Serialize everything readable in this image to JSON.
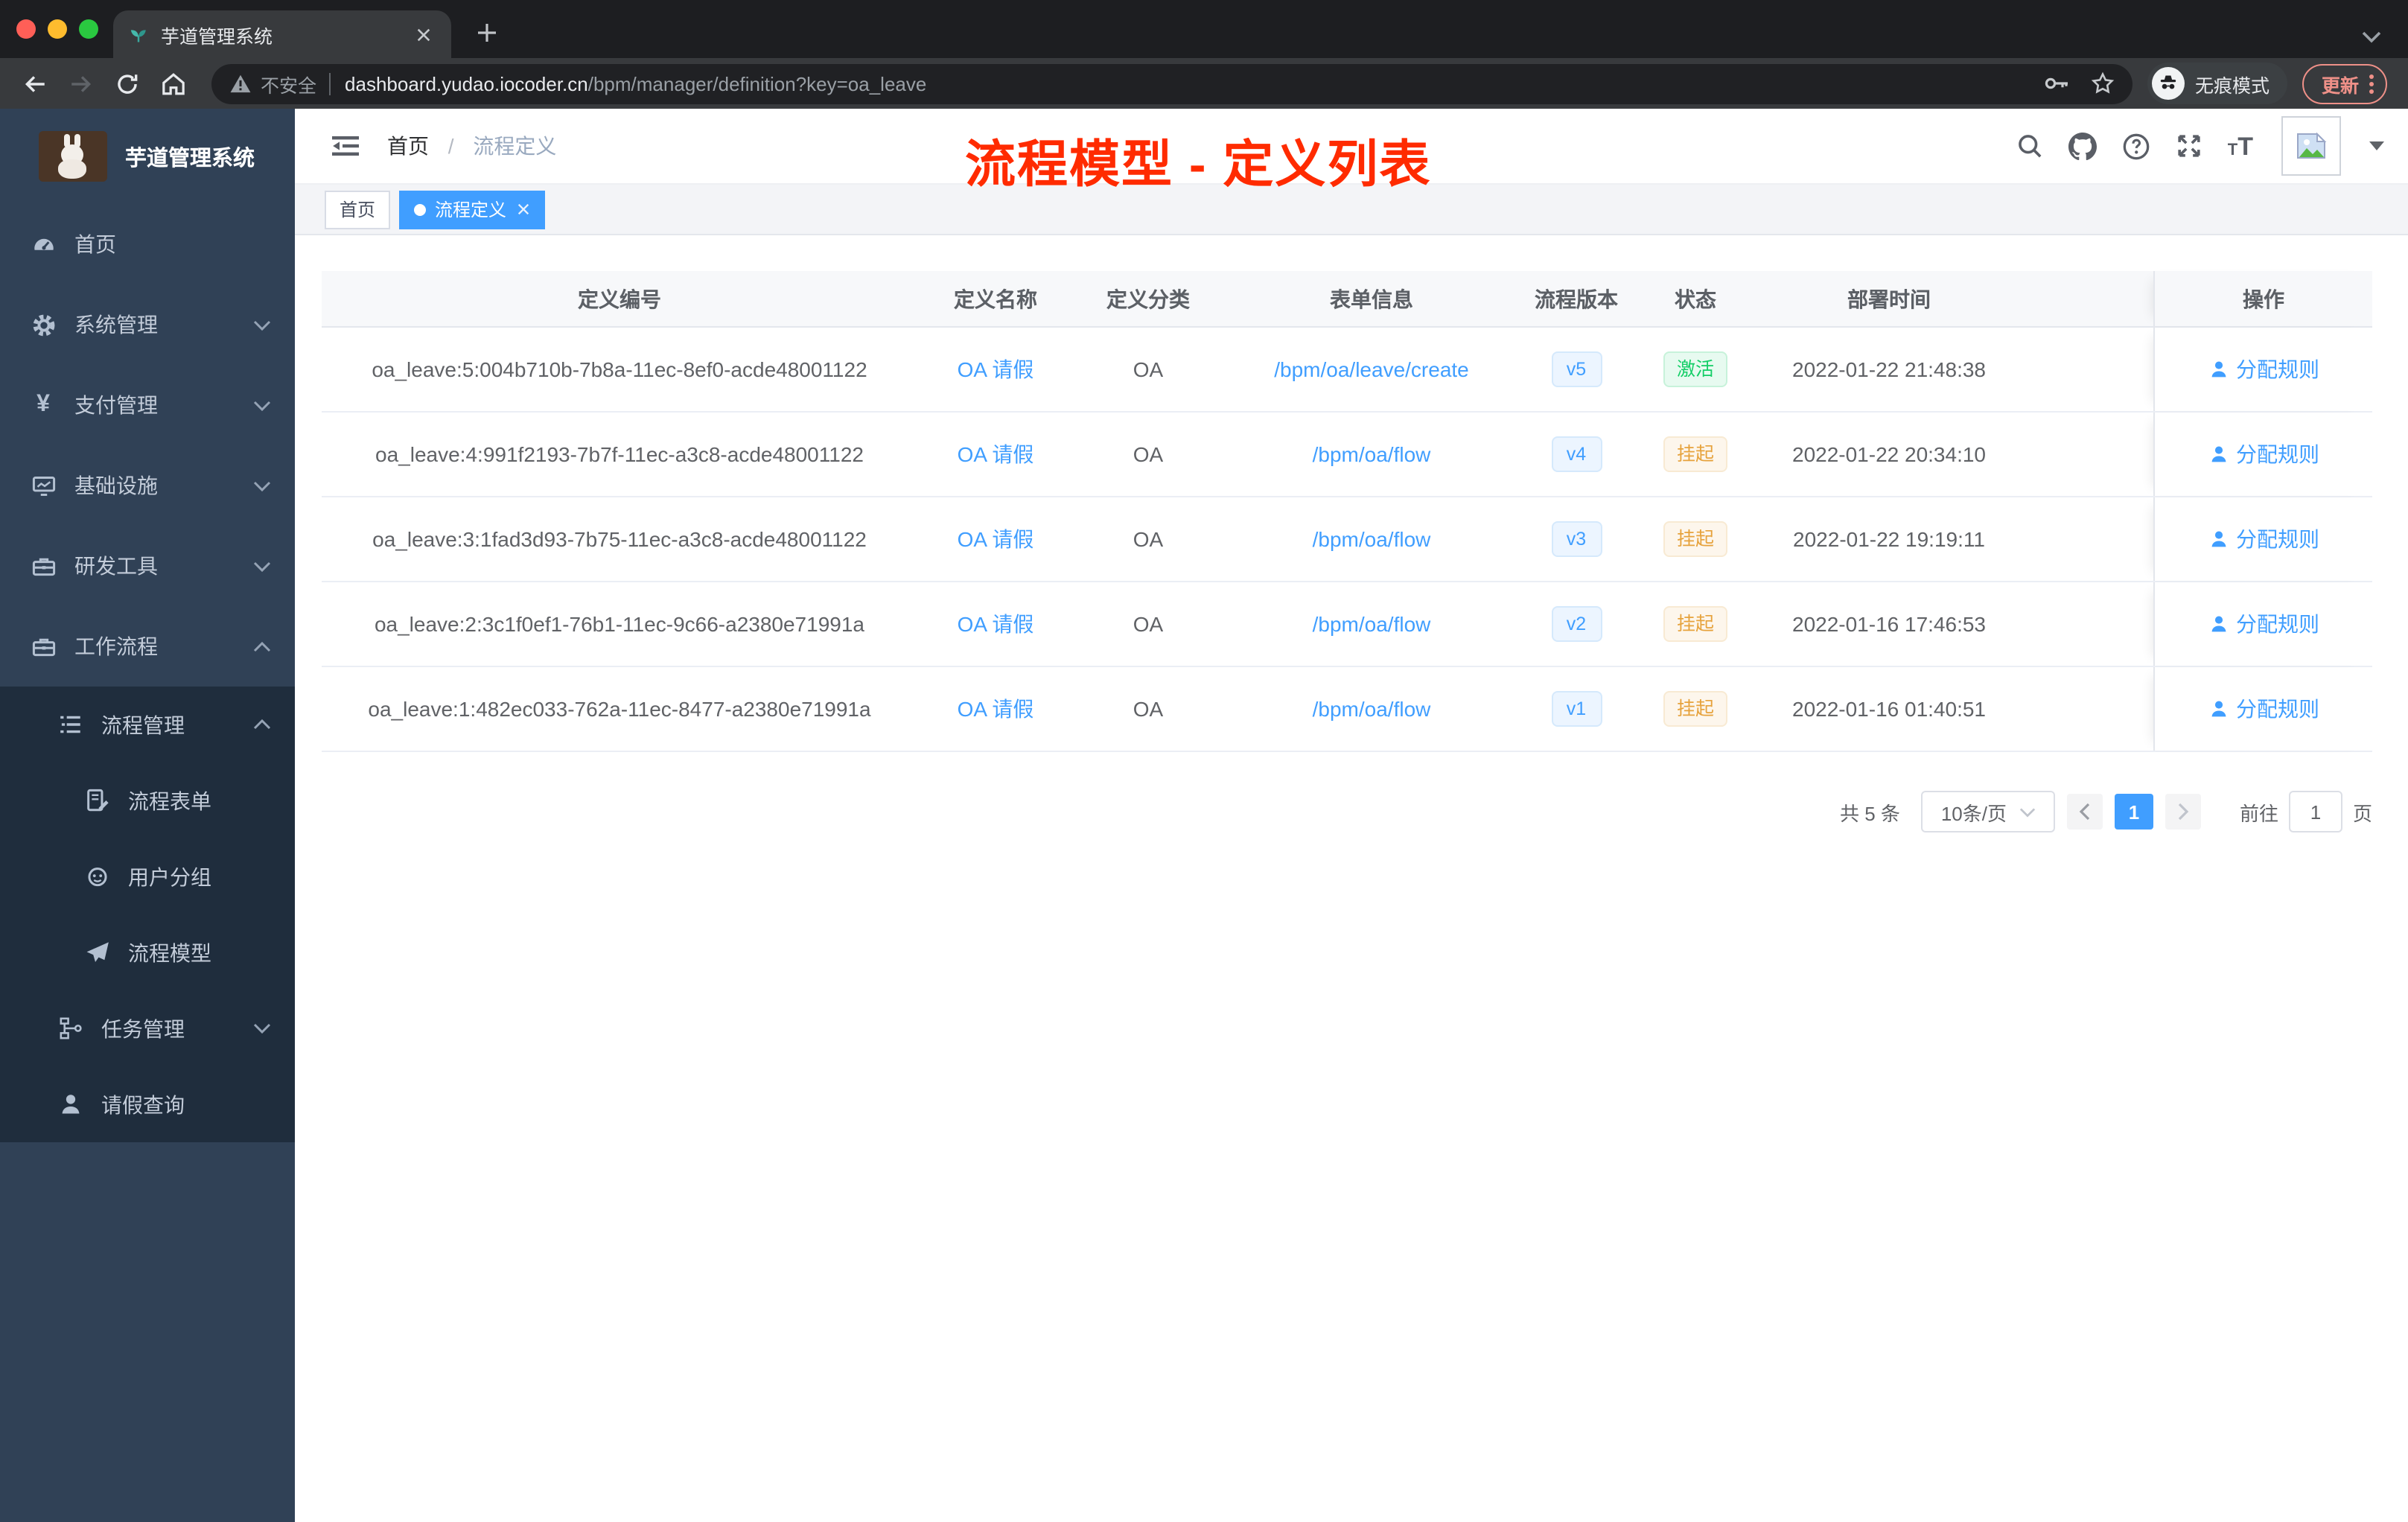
{
  "colors": {
    "accent": "#409eff",
    "success": "#13ce66",
    "warning": "#e6a23c",
    "annotation_red": "#ff2b00",
    "sidebar_bg": "#304156",
    "sidebar_submenu_bg": "#1f2d3d",
    "chrome_update": "#ee9088"
  },
  "browser": {
    "tab_title": "芋道管理系统",
    "security_label": "不安全",
    "url_host": "dashboard.yudao.iocoder.cn",
    "url_path": "/bpm/manager/definition?key=oa_leave",
    "incognito_label": "无痕模式",
    "update_label": "更新"
  },
  "sidebar": {
    "logo_title": "芋道管理系统",
    "items": [
      {
        "label": "首页"
      },
      {
        "label": "系统管理"
      },
      {
        "label": "支付管理"
      },
      {
        "label": "基础设施"
      },
      {
        "label": "研发工具"
      },
      {
        "label": "工作流程"
      },
      {
        "label": "流程管理"
      },
      {
        "label": "流程表单"
      },
      {
        "label": "用户分组"
      },
      {
        "label": "流程模型"
      },
      {
        "label": "任务管理"
      },
      {
        "label": "请假查询"
      }
    ]
  },
  "header": {
    "breadcrumb": {
      "home": "首页",
      "current": "流程定义"
    }
  },
  "tags": {
    "home": "首页",
    "active": "流程定义"
  },
  "annotation": "流程模型 - 定义列表",
  "icons": {
    "yen": "¥",
    "question_mark": "?",
    "font_small": "T",
    "font_big": "T"
  },
  "table": {
    "columns": [
      "定义编号",
      "定义名称",
      "定义分类",
      "表单信息",
      "流程版本",
      "状态",
      "部署时间",
      "操作"
    ],
    "assign_label": "分配规则",
    "rows": [
      {
        "id": "oa_leave:5:004b710b-7b8a-11ec-8ef0-acde48001122",
        "name": "OA 请假",
        "category": "OA",
        "form": "/bpm/oa/leave/create",
        "version": "v5",
        "status": "激活",
        "time": "2022-01-22 21:48:38"
      },
      {
        "id": "oa_leave:4:991f2193-7b7f-11ec-a3c8-acde48001122",
        "name": "OA 请假",
        "category": "OA",
        "form": "/bpm/oa/flow",
        "version": "v4",
        "status": "挂起",
        "time": "2022-01-22 20:34:10"
      },
      {
        "id": "oa_leave:3:1fad3d93-7b75-11ec-a3c8-acde48001122",
        "name": "OA 请假",
        "category": "OA",
        "form": "/bpm/oa/flow",
        "version": "v3",
        "status": "挂起",
        "time": "2022-01-22 19:19:11"
      },
      {
        "id": "oa_leave:2:3c1f0ef1-76b1-11ec-9c66-a2380e71991a",
        "name": "OA 请假",
        "category": "OA",
        "form": "/bpm/oa/flow",
        "version": "v2",
        "status": "挂起",
        "time": "2022-01-16 17:46:53"
      },
      {
        "id": "oa_leave:1:482ec033-762a-11ec-8477-a2380e71991a",
        "name": "OA 请假",
        "category": "OA",
        "form": "/bpm/oa/flow",
        "version": "v1",
        "status": "挂起",
        "time": "2022-01-16 01:40:51"
      }
    ]
  },
  "pagination": {
    "total": "共 5 条",
    "page_size": "10条/页",
    "current": "1",
    "goto_label": "前往",
    "page_label": "页",
    "goto_value": "1"
  }
}
